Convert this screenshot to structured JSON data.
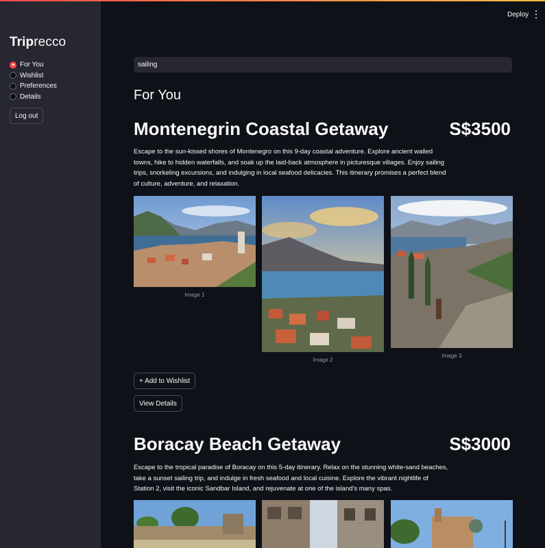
{
  "app": {
    "brand_bold": "Trip",
    "brand_light": "recco",
    "deploy_label": "Deploy"
  },
  "sidebar": {
    "items": [
      {
        "label": "For You",
        "selected": true
      },
      {
        "label": "Wishlist",
        "selected": false
      },
      {
        "label": "Preferences",
        "selected": false
      },
      {
        "label": "Details",
        "selected": false
      }
    ],
    "logout_label": "Log out"
  },
  "search": {
    "value": "sailing"
  },
  "main": {
    "section_title": "For You",
    "trips": [
      {
        "title": "Montenegrin Coastal Getaway",
        "price": "S$3500",
        "description": "Escape to the sun-kissed shores of Montenegro on this 9-day coastal adventure. Explore ancient walled towns, hike to hidden waterfalls, and soak up the laid-back atmosphere in picturesque villages. Enjoy sailing trips, snorkeling excursions, and indulging in local seafood delicacies. This itinerary promises a perfect blend of culture, adventure, and relaxation.",
        "captions": [
          "Image 1",
          "Image 2",
          "Image 3"
        ],
        "wishlist_label": "+ Add to Wishlist",
        "details_label": "View Details"
      },
      {
        "title": "Boracay Beach Getaway",
        "price": "S$3000",
        "description": "Escape to the tropical paradise of Boracay on this 5-day itinerary. Relax on the stunning white-sand beaches, take a sunset sailing trip, and indulge in fresh seafood and local cuisine. Explore the vibrant nightlife of Station 2, visit the iconic Sandbar Island, and rejuvenate at one of the island's many spas."
      }
    ]
  },
  "colors": {
    "background": "#0e1117",
    "sidebar": "#262730",
    "accent": "#ff4b4b"
  }
}
